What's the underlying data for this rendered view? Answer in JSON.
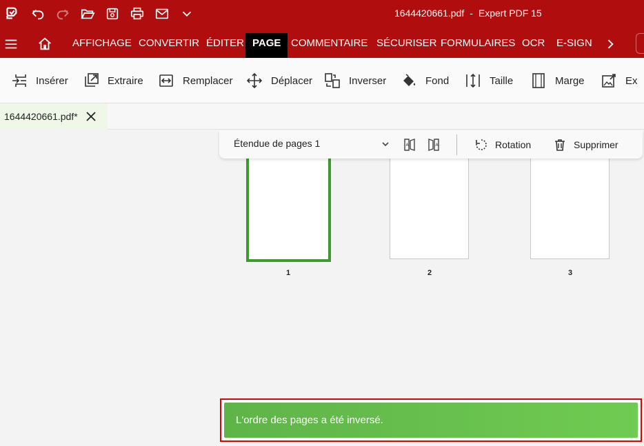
{
  "window": {
    "filename": "1644420661.pdf",
    "separator": "-",
    "app_name": "Expert PDF 15"
  },
  "quick_access": [
    "app-logo-icon",
    "undo-icon",
    "redo-icon",
    "open-folder-icon",
    "save-icon",
    "print-icon",
    "email-icon",
    "chevron-down-icon"
  ],
  "ribbon": {
    "tabs": [
      "AFFICHAGE",
      "CONVERTIR",
      "ÉDITER",
      "PAGE",
      "COMMENTAIRE",
      "SÉCURISER",
      "FORMULAIRES",
      "OCR",
      "E-SIGN"
    ],
    "active_tab": "PAGE"
  },
  "toolbar": {
    "items": [
      {
        "label": "Insérer",
        "icon": "insert-icon"
      },
      {
        "label": "Extraire",
        "icon": "extract-icon"
      },
      {
        "label": "Remplacer",
        "icon": "replace-icon"
      },
      {
        "label": "Déplacer",
        "icon": "move-icon"
      },
      {
        "label": "Inverser",
        "icon": "reverse-icon"
      },
      {
        "label": "Fond",
        "icon": "paint-bucket-icon"
      },
      {
        "label": "Taille",
        "icon": "size-icon"
      },
      {
        "label": "Marge",
        "icon": "margin-icon"
      },
      {
        "label": "Ex",
        "icon": "export-image-icon"
      }
    ]
  },
  "document_tab": {
    "label": "1644420661.pdf*"
  },
  "page_bar": {
    "range_label": "Étendue de pages 1",
    "rotation_label": "Rotation",
    "delete_label": "Supprimer"
  },
  "pages": [
    {
      "number": "1",
      "selected": true
    },
    {
      "number": "2",
      "selected": false
    },
    {
      "number": "3",
      "selected": false
    }
  ],
  "toast": {
    "message": "L'ordre des pages a été inversé.",
    "color": "#6cc451"
  },
  "colors": {
    "brand": "#b00e0e",
    "selection": "#3c9a2e",
    "alert_border": "#e00000"
  }
}
